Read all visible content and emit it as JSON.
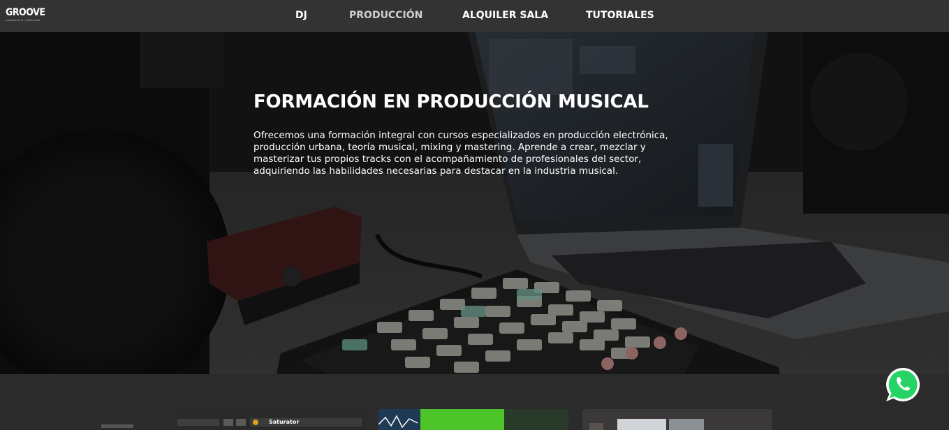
{
  "brand": {
    "logo_word": "GROOVE",
    "logo_tagline": "ACADEMIA DE DJ Y PRODUCCIÓN"
  },
  "nav": {
    "items": [
      {
        "label": "DJ",
        "active": false
      },
      {
        "label": "PRODUCCIÓN",
        "active": true
      },
      {
        "label": "ALQUILER SALA",
        "active": false
      },
      {
        "label": "TUTORIALES",
        "active": false
      }
    ]
  },
  "hero": {
    "title": "FORMACIÓN EN PRODUCCIÓN MUSICAL",
    "description": "Ofrecemos una formación integral con cursos especializados en producción electrónica, producción urbana, teoría musical, mixing y mastering. Aprende a crear, mezclar y masterizar tus propios tracks con el acompañamiento de profesionales del sector, adquiriendo las habilidades necesarias para destacar en la industria musical."
  },
  "cards": [
    {
      "visible_label": "Saturator"
    },
    {
      "visible_label": ""
    },
    {
      "visible_label": ""
    }
  ],
  "icons": {
    "whatsapp": "whatsapp-icon"
  },
  "colors": {
    "navbar_bg": "#333333",
    "hero_text": "#ffffff",
    "section_bg": "#2b2b2b",
    "whatsapp_green": "#25d366"
  }
}
